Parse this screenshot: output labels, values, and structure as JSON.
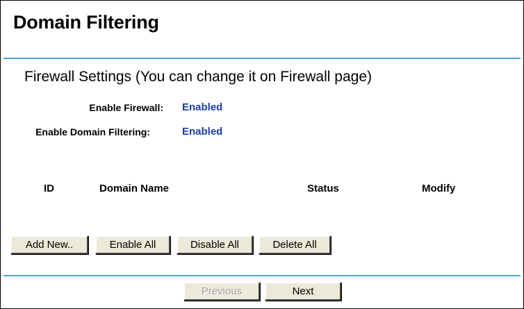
{
  "page": {
    "title": "Domain Filtering"
  },
  "firewall": {
    "heading": "Firewall Settings (You can change it on Firewall page)",
    "enable_firewall_label": "Enable Firewall:",
    "enable_firewall_value": "Enabled",
    "enable_domain_filtering_label": "Enable Domain Filtering:",
    "enable_domain_filtering_value": "Enabled"
  },
  "table": {
    "columns": [
      "ID",
      "Domain Name",
      "Status",
      "Modify"
    ]
  },
  "actions": {
    "add_new": "Add New..",
    "enable_all": "Enable All",
    "disable_all": "Disable All",
    "delete_all": "Delete All"
  },
  "pager": {
    "previous": "Previous",
    "previous_disabled": true,
    "next": "Next"
  },
  "colors": {
    "accent_rule": "#4aa3cf",
    "value_text": "#1b3ea3"
  }
}
